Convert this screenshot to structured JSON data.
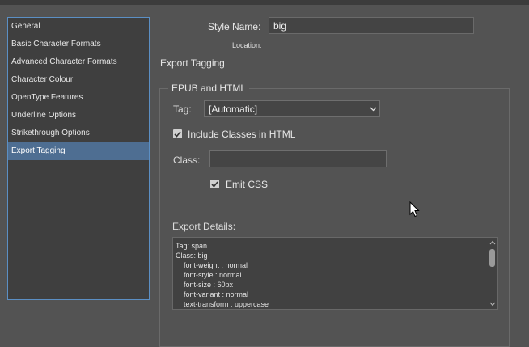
{
  "sidebar": {
    "items": [
      {
        "label": "General"
      },
      {
        "label": "Basic Character Formats"
      },
      {
        "label": "Advanced Character Formats"
      },
      {
        "label": "Character Colour"
      },
      {
        "label": "OpenType Features"
      },
      {
        "label": "Underline Options"
      },
      {
        "label": "Strikethrough Options"
      },
      {
        "label": "Export Tagging",
        "selected": true
      }
    ]
  },
  "header": {
    "style_name_label": "Style Name:",
    "style_name_value": "big",
    "location_label": "Location:"
  },
  "main": {
    "section_title": "Export Tagging",
    "group_title": "EPUB and HTML",
    "tag_label": "Tag:",
    "tag_value": "[Automatic]",
    "include_classes_label": "Include Classes in HTML",
    "include_classes_checked": true,
    "class_label": "Class:",
    "class_value": "",
    "emit_css_label": "Emit CSS",
    "emit_css_checked": true,
    "export_details_label": "Export Details:",
    "export_details_lines": [
      "Tag: span",
      "Class: big",
      "    font-weight : normal",
      "    font-style : normal",
      "    font-size : 60px",
      "    font-variant : normal",
      "    text-transform : uppercase"
    ]
  },
  "icons": {
    "dropdown": "chevron-down-icon",
    "checkbox": "checkmark-icon",
    "scroll_up": "triangle-up-icon",
    "scroll_down": "triangle-down-icon",
    "cursor": "mouse-pointer-icon"
  },
  "colors": {
    "background": "#535353",
    "sidebar_bg": "#3f3f3f",
    "selection": "#4e6e92",
    "sidebar_border": "#5b8fc4"
  }
}
